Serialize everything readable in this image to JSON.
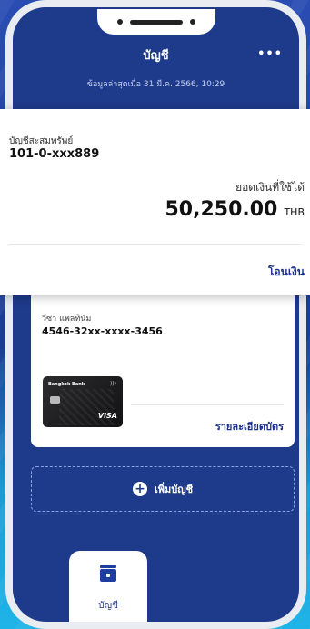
{
  "header": {
    "title": "บัญชี",
    "subtitle": "ข้อมูลล่าสุดเมื่อ 31 มี.ค. 2566, 10:29",
    "more_icon": "more-icon",
    "more_text": "•••"
  },
  "account": {
    "type": "บัญชีสะสมทรัพย์",
    "number": "101-0-xxx889",
    "balance_label": "ยอดเงินที่ใช้ได้",
    "balance": "50,250.00",
    "currency": "THB",
    "transfer_label": "โอนเงิน"
  },
  "card": {
    "type": "วีซ่า แพลทินัม",
    "number": "4546-32xx-xxxx-3456",
    "brand": "Bangkok Bank",
    "network": "VISA",
    "detail_label": "รายละเอียดบัตร"
  },
  "add_account": {
    "label": "เพิ่มบัญชี",
    "icon": "plus-icon"
  },
  "bottom_nav": {
    "label": "บัญชี",
    "icon": "wallet-icon"
  },
  "colors": {
    "primary": "#1e3a8a",
    "accent": "#1b2f8a",
    "white": "#ffffff"
  }
}
